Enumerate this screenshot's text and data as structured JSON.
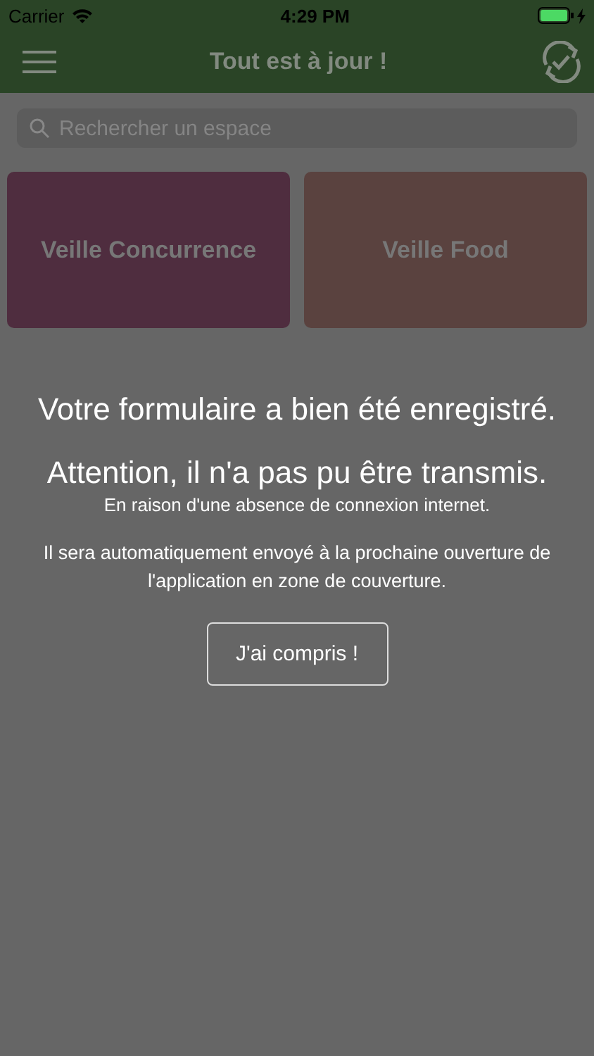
{
  "status_bar": {
    "carrier": "Carrier",
    "time": "4:29 PM",
    "battery": {
      "charging": true
    }
  },
  "nav_bar": {
    "title": "Tout est à jour !"
  },
  "search": {
    "placeholder": "Rechercher un espace"
  },
  "spaces": [
    {
      "label": "Veille Concurrence",
      "color": "#4f2d3f"
    },
    {
      "label": "Veille Food",
      "color": "#5a423f"
    }
  ],
  "message": {
    "title": "Votre formulaire a bien été enregistré.",
    "warning": "Attention, il n'a pas pu être transmis.",
    "reason": "En raison d'une absence de connexion internet.",
    "info": "Il sera automatiquement envoyé à la prochaine ouverture de l'application en zone de couverture.",
    "button": "J'ai compris !"
  }
}
